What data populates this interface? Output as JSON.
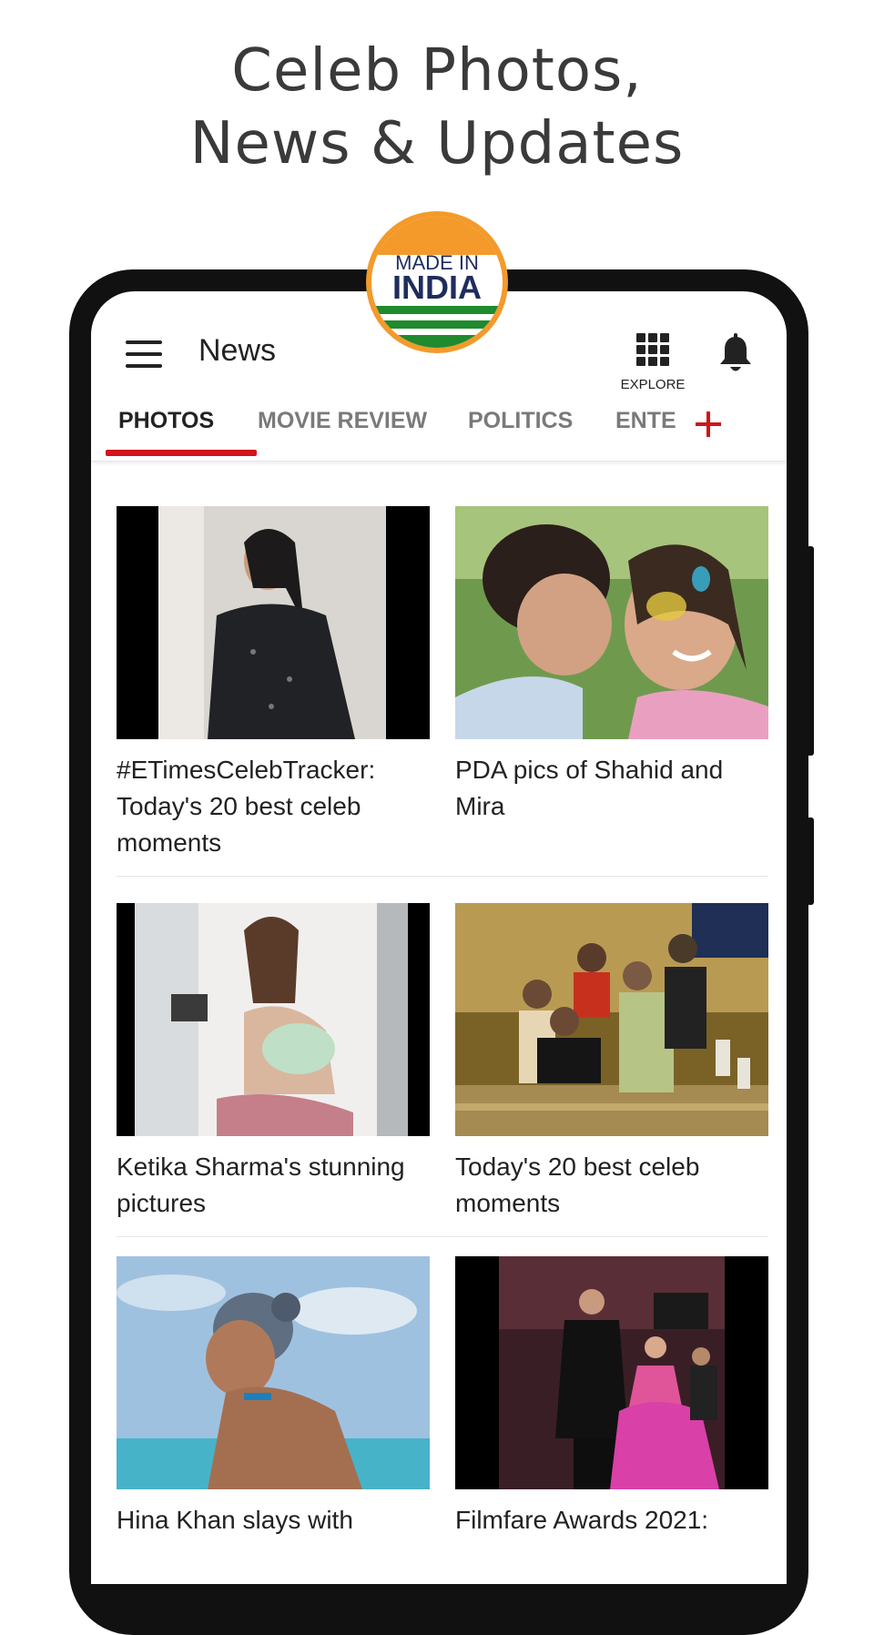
{
  "promo": {
    "headline_line1": "Celeb Photos,",
    "headline_line2": "News & Updates",
    "badge_line1": "MADE IN",
    "badge_line2": "INDIA"
  },
  "appbar": {
    "title": "News",
    "explore_label": "EXPLORE"
  },
  "tabs": [
    {
      "label": "PHOTOS",
      "active": true
    },
    {
      "label": "MOVIE REVIEW",
      "active": false
    },
    {
      "label": "POLITICS",
      "active": false
    },
    {
      "label": "ENTE",
      "active": false
    }
  ],
  "cards": [
    {
      "caption": "#ETimesCelebTracker: Today's 20 best celeb moments"
    },
    {
      "caption": "PDA pics of Shahid and Mira"
    },
    {
      "caption": "Ketika Sharma's stunning pictures"
    },
    {
      "caption": "Today's 20 best celeb moments"
    },
    {
      "caption": "Hina Khan slays with"
    },
    {
      "caption": "Filmfare Awards 2021:"
    }
  ],
  "colors": {
    "accent": "#d0151b",
    "saffron": "#f39a2b",
    "green": "#1f8a2e",
    "navy": "#1f2d5c"
  },
  "icons": [
    "hamburger-icon",
    "grid-icon",
    "bell-icon",
    "plus-icon"
  ]
}
